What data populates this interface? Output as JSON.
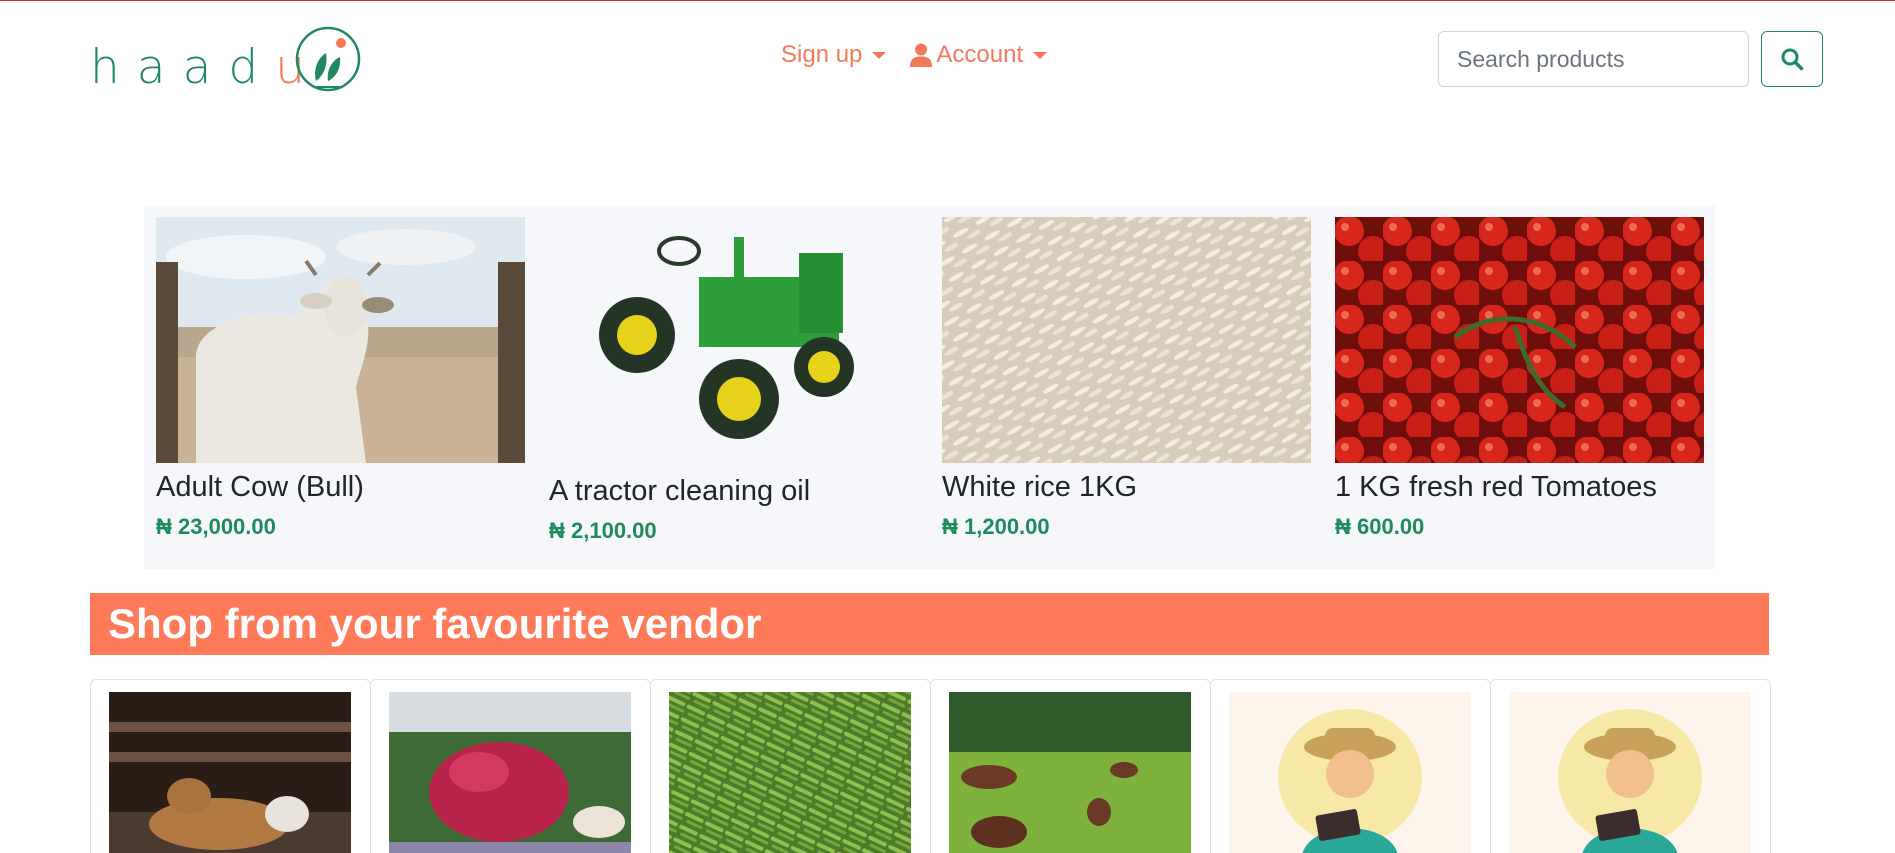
{
  "brand": {
    "name_main": "haad",
    "name_accent": "u"
  },
  "nav": {
    "signup_label": "Sign up",
    "account_label": "Account"
  },
  "search": {
    "placeholder": "Search products"
  },
  "featured": [
    {
      "name": "Adult Cow (Bull)",
      "price": "₦ 23,000.00",
      "image": "cow-photo"
    },
    {
      "name": "A tractor cleaning oil",
      "price": "₦ 2,100.00",
      "image": "tractor-photo"
    },
    {
      "name": "White rice 1KG",
      "price": "₦ 1,200.00",
      "image": "rice-photo"
    },
    {
      "name": "1 KG fresh red Tomatoes",
      "price": "₦ 600.00",
      "image": "tomatoes-photo"
    }
  ],
  "vendors": {
    "heading": "Shop from your favourite vendor",
    "items": [
      {
        "image": "goat-photo"
      },
      {
        "image": "radish-market-photo"
      },
      {
        "image": "green-beans-photo"
      },
      {
        "image": "cattle-field-photo"
      },
      {
        "image": "farmer-avatar"
      },
      {
        "image": "farmer-avatar"
      }
    ]
  },
  "colors": {
    "brand_green": "#1e8a5e",
    "accent_orange": "#f4785a",
    "banner": "#ff7a59"
  }
}
